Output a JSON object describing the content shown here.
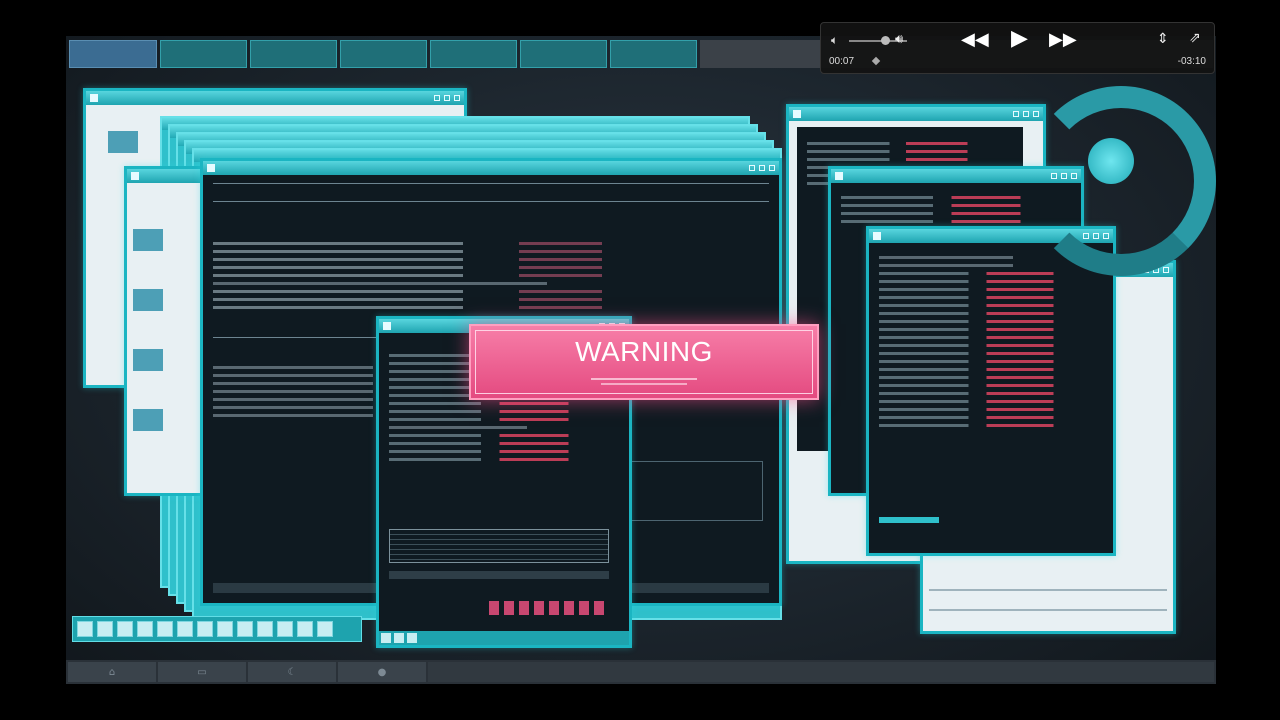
{
  "warning": {
    "title": "WARNING"
  },
  "player": {
    "current_time": "00:07",
    "remaining_time": "-03:10",
    "progress": 0.035,
    "volume": 0.6
  },
  "icons": {
    "volume_low": "volume-low-icon",
    "volume_high": "volume-high-icon",
    "rewind": "rewind-icon",
    "play": "play-icon",
    "fast_forward": "fast-forward-icon",
    "fullscreen": "fullscreen-icon",
    "share": "share-icon"
  },
  "colors": {
    "window_border": "#1bb5c2",
    "warning_pink": "#e44a80",
    "background": "#1c252d"
  }
}
